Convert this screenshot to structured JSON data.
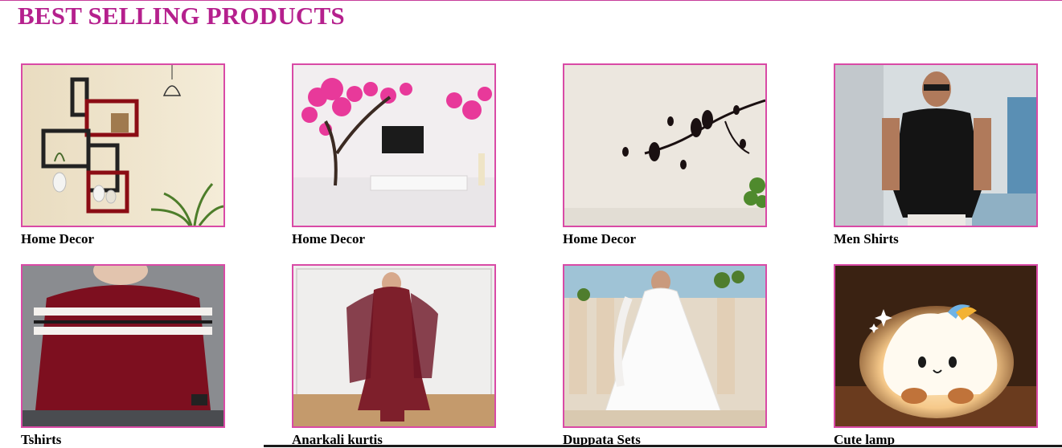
{
  "section": {
    "title": "BEST SELLING PRODUCTS"
  },
  "products": [
    {
      "label": "Home Decor",
      "image": "wall-shelves-photo"
    },
    {
      "label": "Home Decor",
      "image": "tree-wall-sticker-photo"
    },
    {
      "label": "Home Decor",
      "image": "bird-branch-decal-photo"
    },
    {
      "label": "Men Shirts",
      "image": "man-black-shirt-photo"
    },
    {
      "label": "Tshirts",
      "image": "maroon-striped-tshirt-photo"
    },
    {
      "label": "Anarkali kurtis",
      "image": "maroon-anarkali-kurti-photo"
    },
    {
      "label": "Duppata Sets",
      "image": "white-dupatta-set-photo"
    },
    {
      "label": "Cute lamp",
      "image": "cute-cloud-lamp-photo"
    }
  ],
  "colors": {
    "title": "#b5208d",
    "card_border": "#d94aa6"
  }
}
